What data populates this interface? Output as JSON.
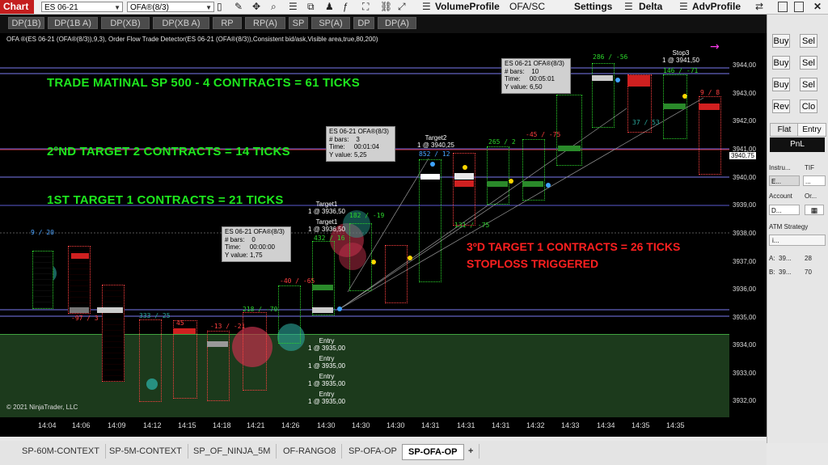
{
  "toolbar": {
    "chart_label": "Chart",
    "instrument": "ES 06-21",
    "bar_type": "OFA®(8/3)",
    "volume_profile": "VolumeProfile",
    "ofa_sc": "OFA/SC",
    "settings": "Settings",
    "delta": "Delta",
    "adv_profile": "AdvProfile"
  },
  "indicator_buttons": [
    "DP(1B)",
    "DP(1B A)",
    "DP(XB)",
    "DP(XB A)",
    "RP",
    "RP(A)",
    "SP",
    "SP(A)",
    "DP",
    "DP(A)"
  ],
  "chart": {
    "info_line": "OFA ®(ES 06-21 (OFA®(8/3)),9,3), Order Flow Trade Detector(ES 06-21 (OFA®(8/3)),Consistent bid/ask,Visible area,true,80,200)",
    "copyright": "© 2021 NinjaTrader, LLC",
    "headline1": "TRADE MATINAL SP 500 - 4 CONTRACTS = 61 TICKS",
    "headline2": "2ºND TARGET  2 CONTRACTS = 14 TICKS",
    "headline3": "1ST TARGET 1 CONTRACTS = 21 TICKS",
    "headline4": "3ºD TARGET  1 CONTRACTS = 26 TICKS",
    "headline5": "STOPLOSS TRIGGERED",
    "tooltips": [
      {
        "l1": "ES 06-21 OFA®(8/3)",
        "l2": "# bars:",
        "v2": "10",
        "l3": "Time:",
        "v3": "00:05:01",
        "l4": "Y value:",
        "v4": "6,50"
      },
      {
        "l1": "ES 06-21 OFA®(8/3)",
        "l2": "# bars:",
        "v2": "3",
        "l3": "Time:",
        "v3": "00:01:04",
        "l4": "Y value:",
        "v4": "5,25"
      },
      {
        "l1": "ES 06-21 OFA®(8/3)",
        "l2": "# bars:",
        "v2": "0",
        "l3": "Time:",
        "v3": "00:00:00",
        "l4": "Y value:",
        "v4": "1,75"
      }
    ],
    "orders": {
      "stop3": "Stop3",
      "stop3_val": "1 @ 3941,50",
      "target2": "Target2",
      "target2_val": "1 @ 3940,25",
      "target1a": "Target1",
      "target1a_val": "1 @ 3936,50",
      "target1b": "Target1",
      "target1b_val": "1 @ 3936,50",
      "entry": "Entry",
      "entry_val": "1 @ 3935,00"
    },
    "bar_labels": [
      "9 / 20",
      "-97 / 3",
      "333 / 25",
      "45",
      "-13 / -21",
      "218 / -70",
      "-40 / -65",
      "432 / 16",
      "182 / -19",
      "852 / 12",
      "265 / 2",
      "-45 / -75",
      "286 / -56",
      "146 / -71",
      "9 / 8",
      "131 / -75",
      "37 / 53"
    ],
    "current_price": "3940,75",
    "price_ticks": [
      "3944,00",
      "3943,00",
      "3942,00",
      "3941,00",
      "3940,00",
      "3939,00",
      "3938,00",
      "3937,00",
      "3936,00",
      "3935,00",
      "3934,00",
      "3933,00",
      "3932,00"
    ],
    "time_ticks": [
      "14:04",
      "14:06",
      "14:09",
      "14:12",
      "14:15",
      "14:18",
      "14:21",
      "14:26",
      "14:30",
      "14:30",
      "14:30",
      "14:31",
      "14:31",
      "14:31",
      "14:32",
      "14:33",
      "14:34",
      "14:35",
      "14:35"
    ]
  },
  "right_panel": {
    "buy": "Buy",
    "sell": "Sel",
    "rev": "Rev",
    "close": "Clo",
    "flat": "Flat",
    "entry": "Entry",
    "pnl": "PnL",
    "instrument_lbl": "Instru...",
    "tif_lbl": "TIF",
    "instrument_val": "E...",
    "tif_val": "...",
    "account_lbl": "Account",
    "order_lbl": "Or...",
    "account_val": "D...",
    "atm_lbl": "ATM Strategy",
    "atm_val": "i...",
    "a_lbl": "A:",
    "a_price": "39...",
    "a_size": "28",
    "b_lbl": "B:",
    "b_price": "39...",
    "b_size": "70"
  },
  "tabs": [
    "SP-60M-CONTEXT",
    "SP-5M-CONTEXT",
    "SP_OF_NINJA_5M",
    "OF-RANGO8",
    "SP-OFA-OP",
    "SP-OFA-OP",
    "+"
  ],
  "colors": {
    "accent_red": "#c41e1e",
    "headline_green": "#1ee81e",
    "headline_red": "#ff2020",
    "zone_green": "#1c3a1c"
  }
}
